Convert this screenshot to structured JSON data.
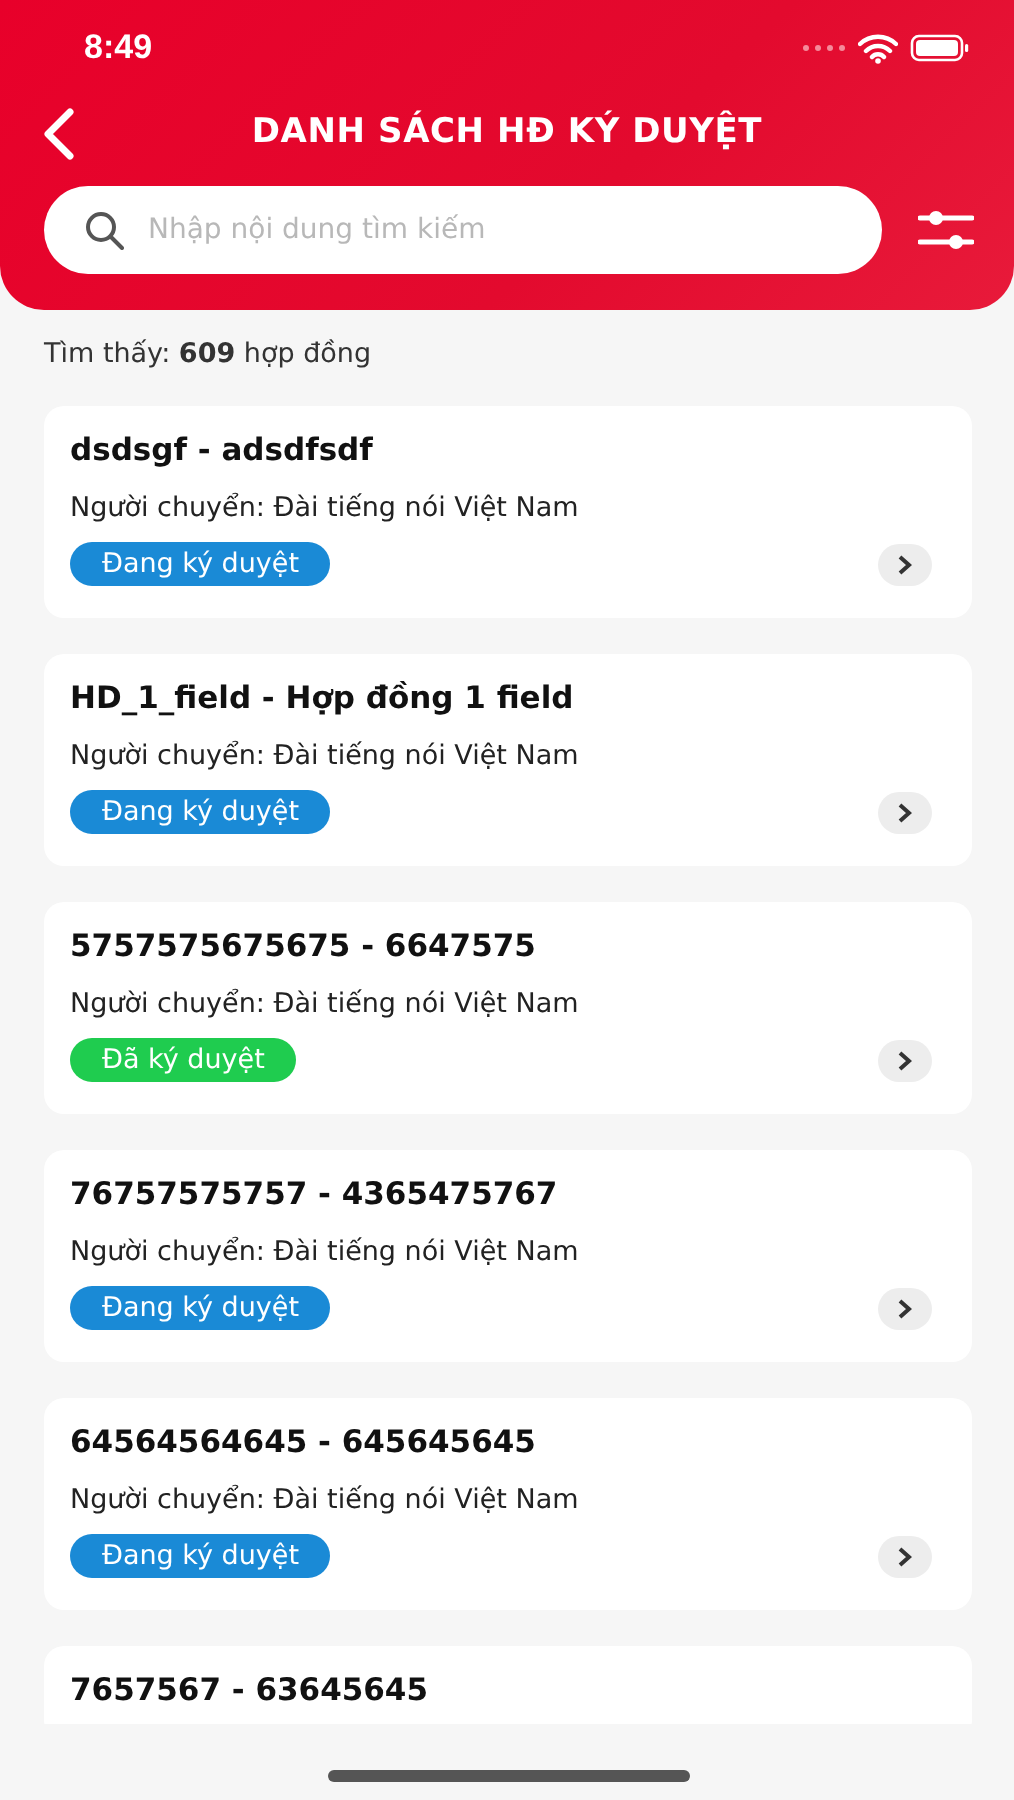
{
  "status_bar": {
    "time": "8:49"
  },
  "header": {
    "title": "DANH SÁCH HĐ KÝ DUYỆT",
    "search": {
      "placeholder": "Nhập nội dung tìm kiếm"
    }
  },
  "result_count": "Tìm thấy: **609** hợp đồng",
  "contracts": [
    {
      "title": "dsdsgf - adsdfsdf",
      "sender": "Người chuyển: Đài tiếng nói Việt Nam",
      "status": {
        "label": "Đang ký duyệt",
        "kind": "pending"
      }
    },
    {
      "title": "HD_1_field - Hợp đồng 1 field",
      "sender": "Người chuyển: Đài tiếng nói Việt Nam",
      "status": {
        "label": "Đang ký duyệt",
        "kind": "pending"
      }
    },
    {
      "title": "5757575675675 - 6647575",
      "sender": "Người chuyển: Đài tiếng nói Việt Nam",
      "status": {
        "label": "Đã ký duyệt",
        "kind": "done"
      }
    },
    {
      "title": "76757575757 - 4365475767",
      "sender": "Người chuyển: Đài tiếng nói Việt Nam",
      "status": {
        "label": "Đang ký duyệt",
        "kind": "pending"
      }
    },
    {
      "title": "64564564645 - 645645645",
      "sender": "Người chuyển: Đài tiếng nói Việt Nam",
      "status": {
        "label": "Đang ký duyệt",
        "kind": "pending"
      }
    },
    {
      "title": "7657567 - 63645645"
    }
  ]
}
